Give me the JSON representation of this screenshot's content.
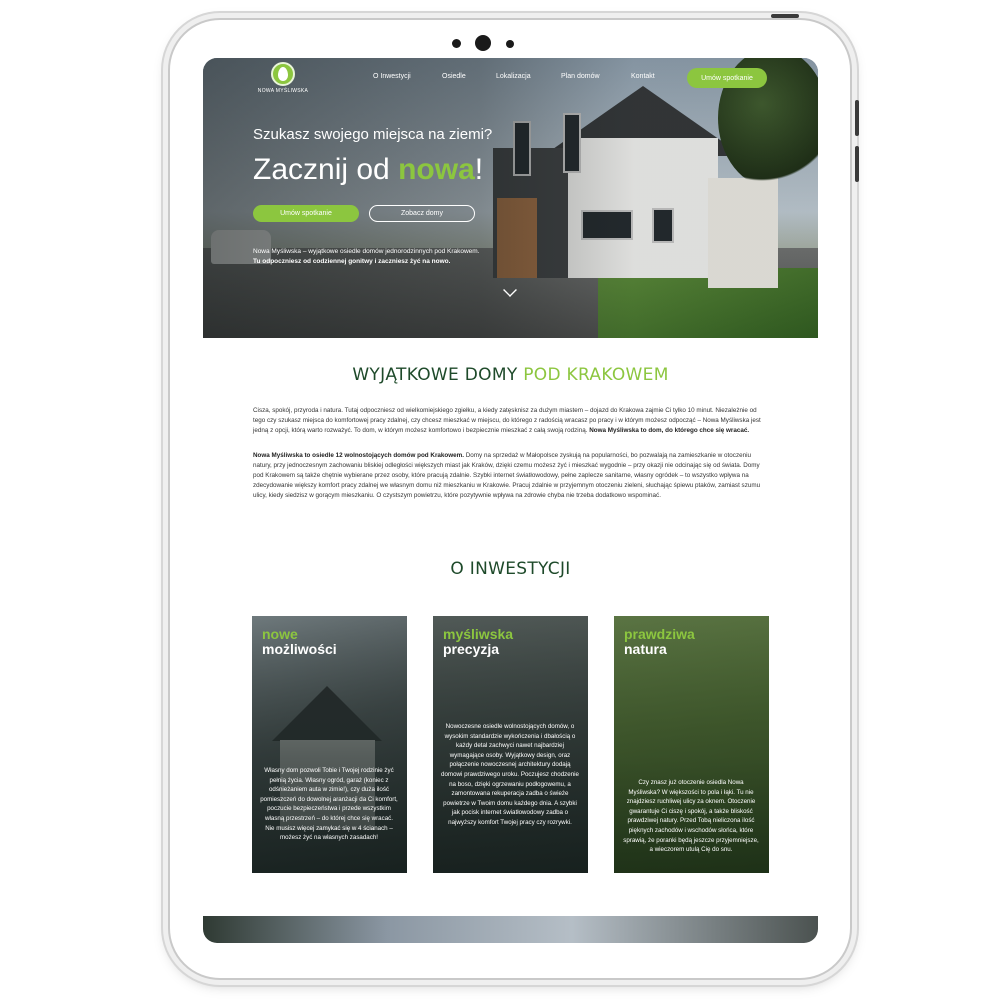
{
  "nav": {
    "logo_text": "NOWA MYŚLIWSKA",
    "items": [
      "O Inwestycji",
      "Osiedle",
      "Lokalizacja",
      "Plan domów",
      "Kontakt"
    ],
    "cta": "Umów spotkanie"
  },
  "hero": {
    "subtitle": "Szukasz swojego miejsca na ziemi?",
    "title_prefix": "Zacznij od ",
    "title_highlight": "nowa",
    "title_suffix": "!",
    "button_primary": "Umów spotkanie",
    "button_secondary": "Zobacz domy",
    "desc_line1": "Nowa Myśliwska – wyjątkowe osiedle domów jednorodzinnych pod Krakowem.",
    "desc_line2": "Tu odpoczniesz od codziennej gonitwy i zaczniesz żyć na nowo."
  },
  "intro": {
    "title_part1": "WYJĄTKOWE DOMY ",
    "title_part2": "POD KRAKOWEM",
    "p1": "Cisza, spokój, przyroda i natura. Tutaj odpoczniesz od wielkomiejskiego zgiełku, a kiedy zatęsknisz za dużym miastem – dojazd do Krakowa zajmie Ci tylko 10 minut. Niezależnie od tego czy szukasz miejsca do komfortowej pracy zdalnej, czy chcesz mieszkać w miejscu, do którego z radością wracasz po pracy i w którym możesz odpocząć – Nowa Myśliwska jest jedną z opcji, którą warto rozważyć. To dom, w którym możesz komfortowo i bezpiecznie mieszkać z całą swoją rodziną.",
    "p1_bold": "Nowa Myśliwska to dom, do którego chce się wracać.",
    "p2_bold": "Nowa Myśliwska to osiedle 12 wolnostojących domów pod Krakowem.",
    "p2": " Domy na sprzedaż w Małopolsce zyskują na popularności, bo pozwalają na zamieszkanie w otoczeniu natury, przy jednoczesnym zachowaniu bliskiej odległości większych miast jak Kraków, dzięki czemu możesz żyć i mieszkać wygodnie – przy okazji nie odcinając się od świata. Domy pod Krakowem są także chętnie wybierane przez osoby, które pracują zdalnie. Szybki internet światłowodowy, pełne zaplecze sanitarne, własny ogródek – to wszystko wpływa na zdecydowanie większy komfort pracy zdalnej we własnym domu niż mieszkaniu w Krakowie. Pracuj zdalnie w przyjemnym otoczeniu zieleni, słuchając śpiewu ptaków, zamiast szumu ulicy, kiedy siedzisz w gorącym mieszkaniu. O czystszym powietrzu, które pozytywnie wpływa na zdrowie chyba nie trzeba dodatkowo wspominać."
  },
  "investment": {
    "title": "O INWESTYCJI",
    "cards": [
      {
        "h1": "nowe",
        "h2": "możliwości",
        "body": "Własny dom pozwoli Tobie i Twojej rodzinie żyć pełnią życia. Własny ogród, garaż (koniec z odśnieżaniem auta w zimie!), czy duża ilość pomieszczeń do dowolnej aranżacji da Ci komfort, poczucie bezpieczeństwa i przede wszystkim własną przestrzeń – do której chce się wracać. Nie musisz więcej zamykać się w 4 ścianach – możesz żyć na własnych zasadach!"
      },
      {
        "h1": "myśliwska",
        "h2": "precyzja",
        "body": "Nowoczesne osiedle wolnostojących domów, o wysokim standardzie wykończenia i dbałością o każdy detal zachwyci nawet najbardziej wymagające osoby. Wyjątkowy design, oraz połączenie nowoczesnej architektury dodają domowi prawdziwego uroku. Poczujesz chodzenie na boso, dzięki ogrzewaniu podłogowemu, a zamontowana rekuperacja zadba o świeże powietrze w Twoim domu każdego dnia. A szybki jak pocisk internet światłowodowy zadba o najwyższy komfort Twojej pracy czy rozrywki."
      },
      {
        "h1": "prawdziwa",
        "h2": "natura",
        "body": "Czy znasz już otoczenie osiedla Nowa Myśliwska? W większości to pola i łąki. Tu nie znajdziesz ruchliwej ulicy za oknem. Otoczenie gwarantuje Ci ciszę i spokój, a także bliskość prawdziwej natury. Przed Tobą nieliczona ilość pięknych zachodów i wschodów słońca, które sprawią, że poranki będą jeszcze przyjemniejsze, a wieczorem utulą Cię do snu."
      }
    ]
  },
  "colors": {
    "accent": "#8cc63f",
    "heading": "#1e4a2a",
    "text": "#333333"
  }
}
